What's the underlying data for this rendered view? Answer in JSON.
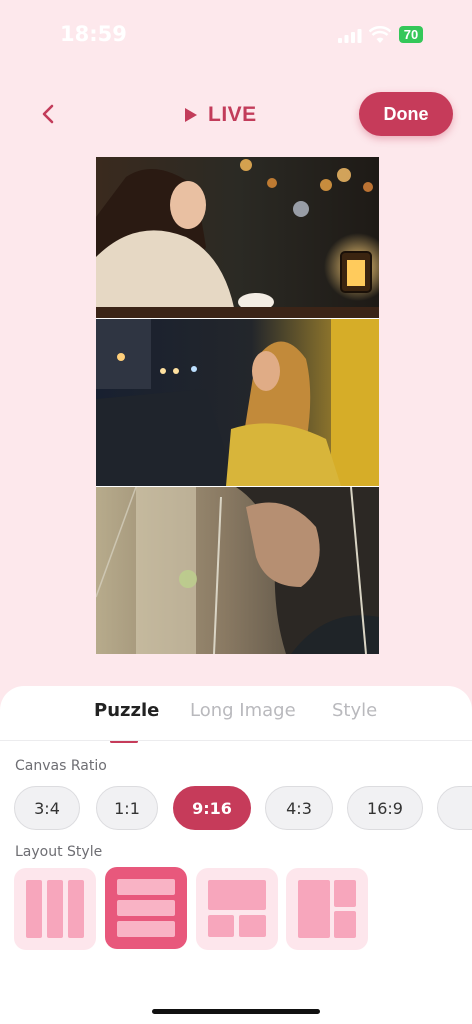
{
  "status_bar": {
    "time": "18:59",
    "battery": "70",
    "signal_icon": "cellular-signal-icon",
    "wifi_icon": "wifi-icon"
  },
  "nav": {
    "back_icon": "chevron-left-icon",
    "live_icon": "play-icon",
    "live_label": "LIVE",
    "done_label": "Done"
  },
  "collage": {
    "photos": [
      {
        "name": "woman-by-rainy-window-photo"
      },
      {
        "name": "woman-in-yellow-jacket-street-photo"
      },
      {
        "name": "woman-under-umbrella-photo"
      }
    ]
  },
  "tabs": [
    "Puzzle",
    "Long Image",
    "Style"
  ],
  "active_tab": "Puzzle",
  "canvas_ratio": {
    "label": "Canvas Ratio",
    "options": [
      "3:4",
      "1:1",
      "9:16",
      "4:3",
      "16:9",
      ""
    ],
    "selected": "9:16"
  },
  "layout_style": {
    "label": "Layout Style",
    "options": [
      "three-columns",
      "three-rows",
      "top-wide-two-bottom",
      "left-tall-two-right"
    ],
    "selected": "three-rows"
  },
  "colors": {
    "accent": "#c63b5a",
    "background": "#fde8ec",
    "layout_tile": "#fde6ec",
    "layout_tile_active": "#e8587c",
    "layout_block": "#f7a6bc"
  }
}
